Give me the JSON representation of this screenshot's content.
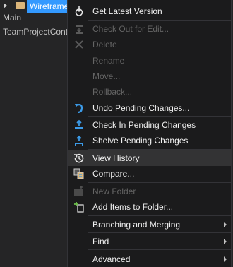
{
  "explorer": {
    "selected_item": "Wireframe",
    "items": [
      "Main",
      "TeamProjectCont"
    ]
  },
  "menu": {
    "items": [
      {
        "label": "Get Latest Version",
        "icon": "get-latest-icon",
        "enabled": true
      },
      {
        "label": "Check Out for Edit...",
        "icon": "check-out-icon",
        "enabled": false
      },
      {
        "label": "Delete",
        "icon": "delete-icon",
        "enabled": false
      },
      {
        "label": "Rename",
        "icon": "",
        "enabled": false
      },
      {
        "label": "Move...",
        "icon": "",
        "enabled": false
      },
      {
        "label": "Rollback...",
        "icon": "",
        "enabled": false
      },
      {
        "label": "Undo Pending Changes...",
        "icon": "undo-icon",
        "enabled": true
      },
      {
        "label": "Check In Pending Changes",
        "icon": "check-in-icon",
        "enabled": true
      },
      {
        "label": "Shelve Pending Changes",
        "icon": "shelve-icon",
        "enabled": true
      },
      {
        "label": "View History",
        "icon": "history-icon",
        "enabled": true,
        "highlighted": true
      },
      {
        "label": "Compare...",
        "icon": "compare-icon",
        "enabled": true
      },
      {
        "label": "New Folder",
        "icon": "new-folder-icon",
        "enabled": false
      },
      {
        "label": "Add Items to Folder...",
        "icon": "add-items-icon",
        "enabled": true
      },
      {
        "label": "Branching and Merging",
        "icon": "",
        "enabled": true,
        "submenu": true
      },
      {
        "label": "Find",
        "icon": "",
        "enabled": true,
        "submenu": true
      },
      {
        "label": "Advanced",
        "icon": "",
        "enabled": true,
        "submenu": true
      }
    ]
  },
  "colors": {
    "menu_bg": "#1b1b1c",
    "highlight": "#333334",
    "selection": "#3399ff",
    "icon_blue": "#3c9be8",
    "disabled_text": "#656565"
  }
}
